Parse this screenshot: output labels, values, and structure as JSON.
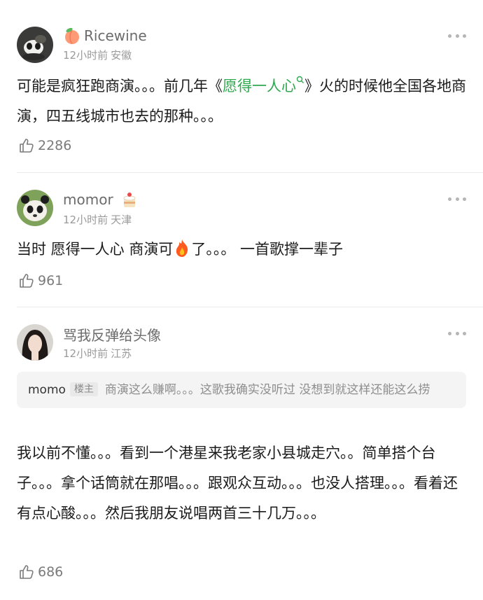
{
  "comments": [
    {
      "user": "Ricewine",
      "badge_icon": "peach-icon",
      "time": "12小时前",
      "location": "安徽",
      "text_before": "可能是疯狂跑商演。。。前几年《",
      "link_text": "愿得一人心",
      "text_after": "》火的时候他全国各地商演，四五线城市也去的那种。。。",
      "likes": "2286"
    },
    {
      "user": "momor",
      "badge_icon": "cake-icon",
      "time": "12小时前",
      "location": "天津",
      "text_before": "当时 愿得一人心 商演可",
      "text_after": "了。。。 一首歌撑一辈子",
      "likes": "961"
    },
    {
      "user": "骂我反弹给头像",
      "time": "12小时前",
      "location": "江苏",
      "quote": {
        "user": "momo",
        "badge": "楼主",
        "text": "商演这么赚啊。。。这歌我确实没听过 没想到就这样还能这么捞"
      },
      "text": "我以前不懂。。。看到一个港星来我老家小县城走穴。。简单搭个台子。。。拿个话筒就在那唱。。。跟观众互动。。。也没人搭理。。。看着还有点心酸。。。然后我朋友说唱两首三十几万。。。",
      "likes": "686"
    }
  ],
  "colors": {
    "link": "#2fa84f",
    "name": "#6b6b6b",
    "meta": "#9a9a9a"
  }
}
